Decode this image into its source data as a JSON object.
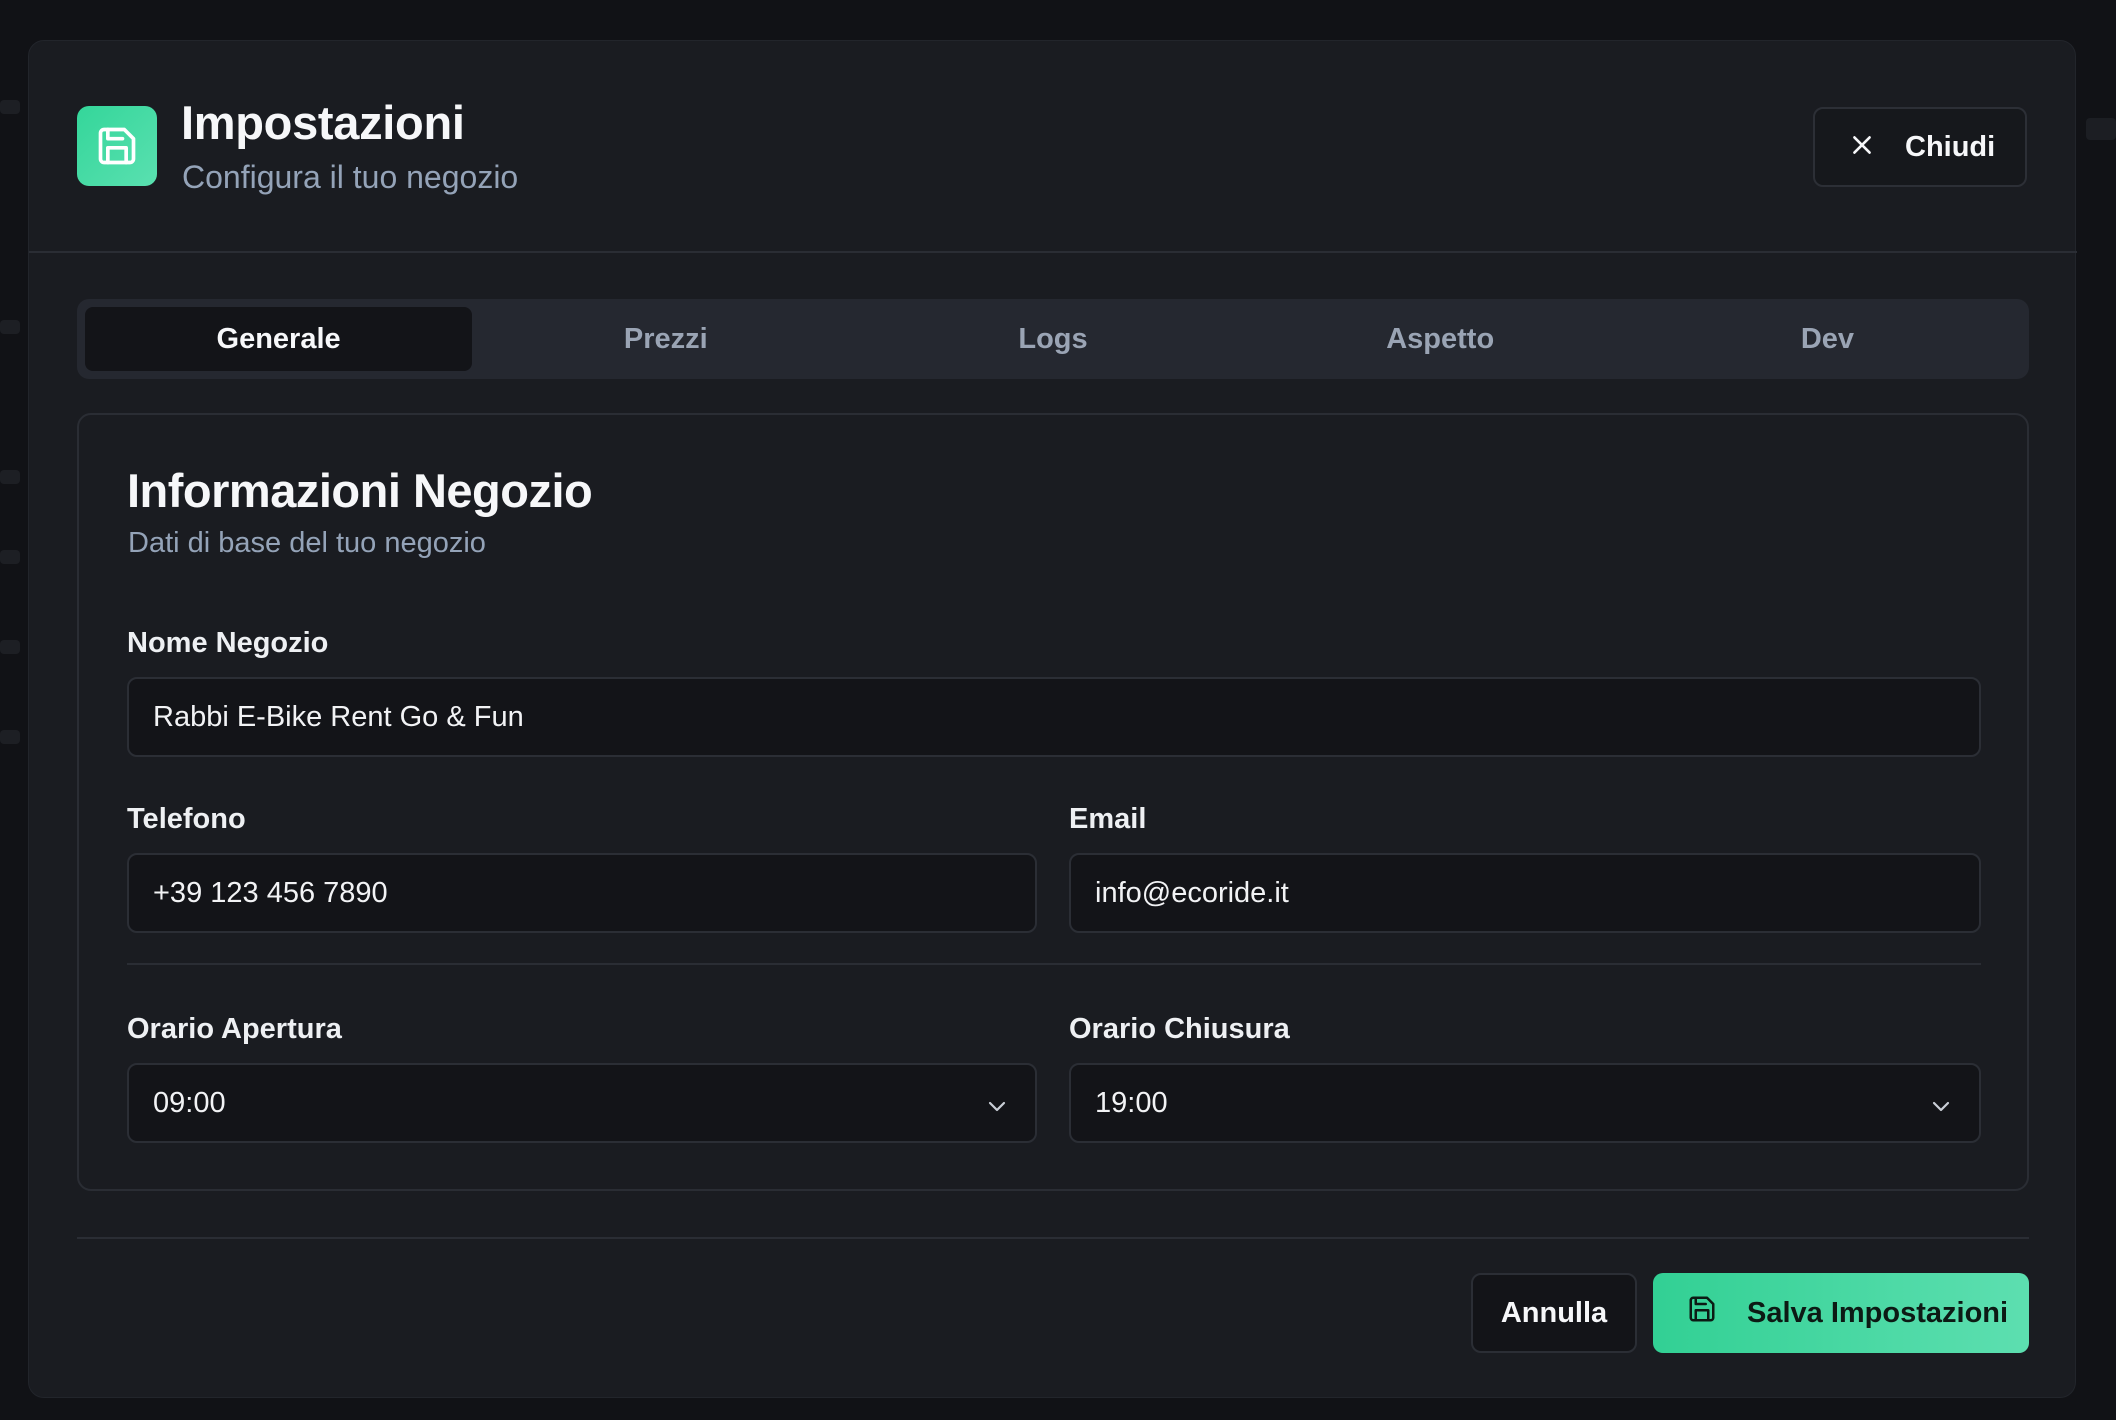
{
  "header": {
    "title": "Impostazioni",
    "subtitle": "Configura il tuo negozio",
    "logo_icon": "save-icon",
    "close_label": "Chiudi"
  },
  "tabs": [
    {
      "label": "Generale",
      "active": true
    },
    {
      "label": "Prezzi",
      "active": false
    },
    {
      "label": "Logs",
      "active": false
    },
    {
      "label": "Aspetto",
      "active": false
    },
    {
      "label": "Dev",
      "active": false
    }
  ],
  "card": {
    "title": "Informazioni Negozio",
    "subtitle": "Dati di base del tuo negozio",
    "shop_name": {
      "label": "Nome Negozio",
      "value": "Rabbi E-Bike Rent Go & Fun"
    },
    "phone": {
      "label": "Telefono",
      "value": "+39 123 456 7890"
    },
    "email": {
      "label": "Email",
      "value": "info@ecoride.it"
    },
    "opening": {
      "label": "Orario Apertura",
      "value": "09:00"
    },
    "closing": {
      "label": "Orario Chiusura",
      "value": "19:00"
    }
  },
  "footer": {
    "cancel_label": "Annulla",
    "save_label": "Salva Impostazioni",
    "save_icon": "save-icon"
  },
  "colors": {
    "accent": "#34d69a",
    "background": "#1a1c21",
    "muted_text": "#94a3b8"
  }
}
